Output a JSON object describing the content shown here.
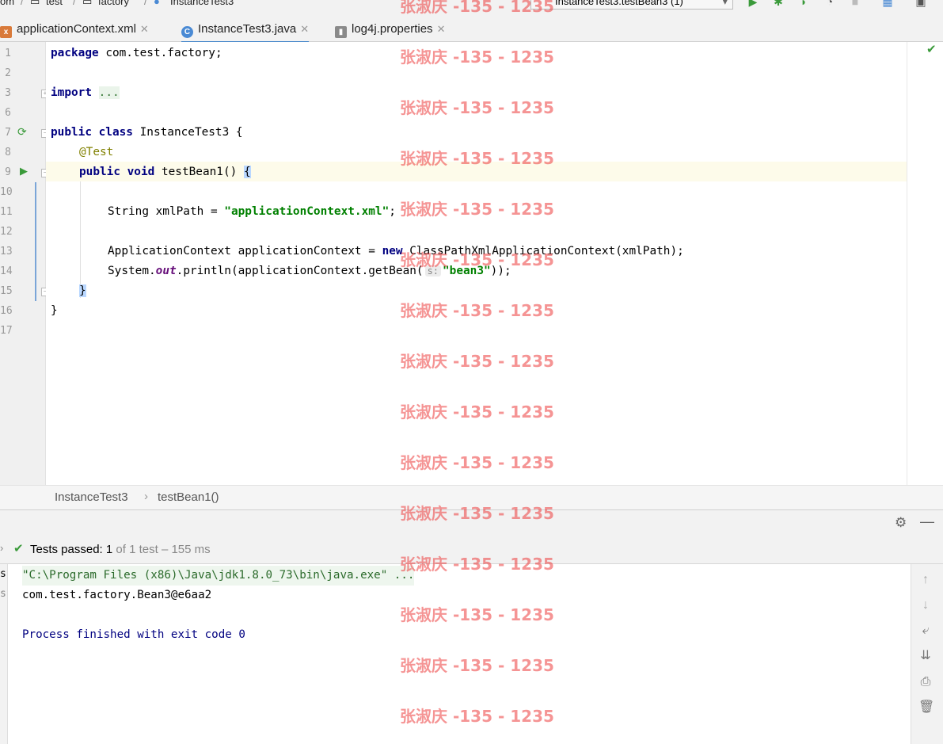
{
  "navbar": {
    "crumbs": [
      "om",
      "test",
      "factory",
      "InstanceTest3"
    ],
    "run_config": "InstanceTest3.testBean3 (1)"
  },
  "tabs": [
    {
      "label": "applicationContext.xml",
      "icon": "xml-file-icon",
      "active": false
    },
    {
      "label": "InstanceTest3.java",
      "icon": "java-class-icon",
      "active": true
    },
    {
      "label": "log4j.properties",
      "icon": "properties-file-icon",
      "active": false
    }
  ],
  "editor": {
    "line_numbers": [
      "1",
      "2",
      "3",
      "6",
      "7",
      "8",
      "9",
      "10",
      "11",
      "12",
      "13",
      "14",
      "15",
      "16",
      "17"
    ],
    "lines": {
      "l1_kw": "package",
      "l1_rest": " com.test.factory;",
      "l3_kw": "import",
      "l3_fold": "...",
      "l7_kw": "public class",
      "l7_rest": " InstanceTest3 {",
      "l8_ann": "@Test",
      "l9_kw": "public void",
      "l9_rest": " testBean1() ",
      "l9_brace": "{",
      "l11_pre": "String xmlPath = ",
      "l11_str": "\"applicationContext.xml\"",
      "l11_post": ";",
      "l13_pre": "ApplicationContext applicationContext = ",
      "l13_kw": "new",
      "l13_post": " ClassPathXmlApplicationContext(xmlPath);",
      "l14_pre": "System.",
      "l14_stat": "out",
      "l14_mid": ".println(applicationContext.getBean(",
      "l14_hint": "s:",
      "l14_str": "\"bean3\"",
      "l14_post": "));",
      "l15": "}",
      "l16": "}"
    }
  },
  "breadcrumbs": [
    "InstanceTest3",
    "testBean1()"
  ],
  "run": {
    "status_label": "Tests passed:",
    "status_count": "1",
    "status_rest": "of 1 test – 155 ms",
    "console": [
      "\"C:\\Program Files (x86)\\Java\\jdk1.8.0_73\\bin\\java.exe\" ...",
      "com.test.factory.Bean3@e6aa2",
      "Process finished with exit code 0"
    ],
    "sidebar_fragments": [
      "s",
      "s"
    ]
  },
  "watermark": "张淑庆 -135 - 1235",
  "colors": {
    "keyword": "#000080",
    "string": "#008000",
    "annotation": "#808000",
    "success": "#3a9a3a",
    "watermark": "#ec3c3c"
  }
}
